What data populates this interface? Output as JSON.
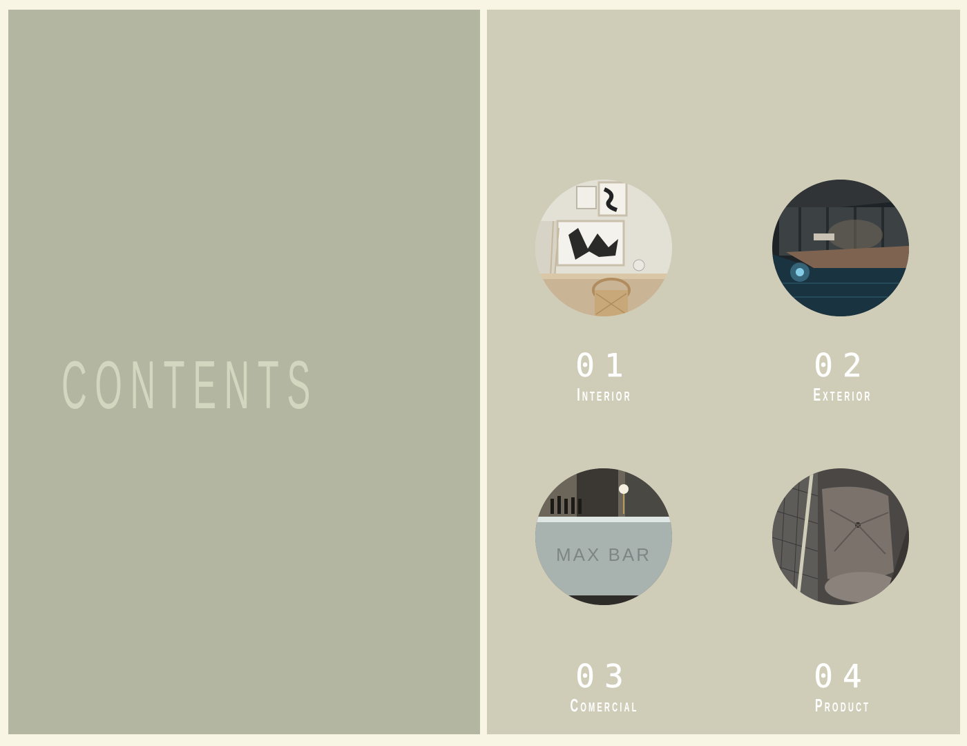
{
  "page": {
    "title": "CONTENTS",
    "colors": {
      "background": "#f8f5e4",
      "left_panel": "#b3b6a0",
      "right_panel": "#cfcdb8",
      "title_text": "#d4d7bf",
      "item_text": "#ffffff"
    }
  },
  "sections": [
    {
      "number": "01",
      "label": "Interior",
      "image": "interior-dining-icon"
    },
    {
      "number": "02",
      "label": "Exterior",
      "image": "exterior-pool-icon"
    },
    {
      "number": "03",
      "label": "Comercial",
      "image": "bar-counter-icon",
      "image_text": "MAX BAR"
    },
    {
      "number": "04",
      "label": "Product",
      "image": "leather-chair-icon"
    }
  ]
}
